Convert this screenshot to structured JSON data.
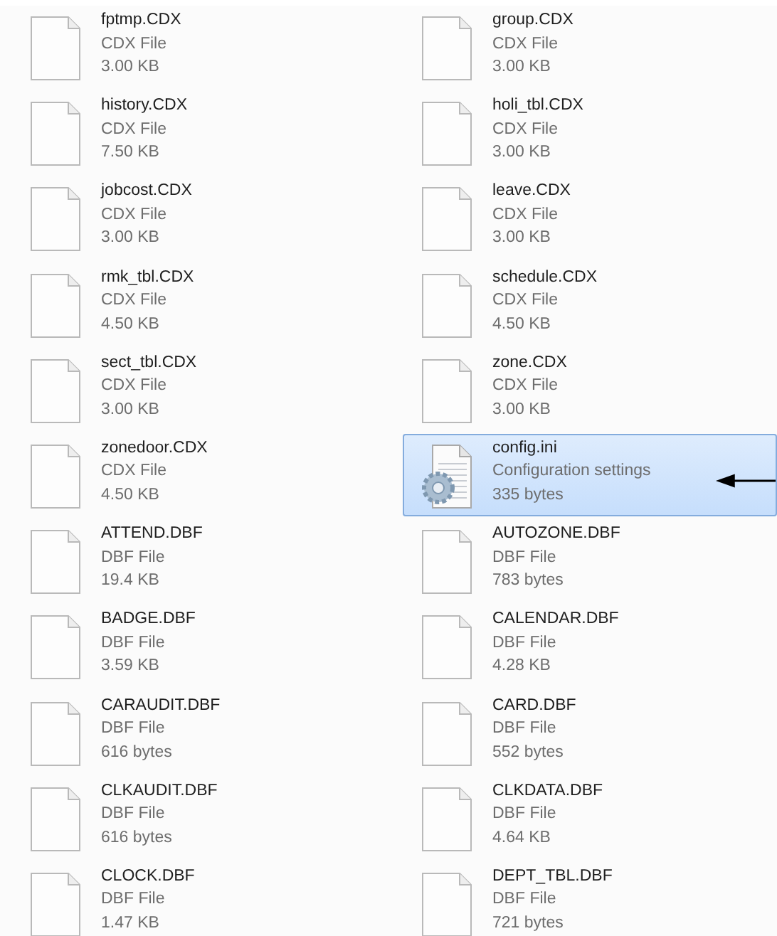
{
  "files": [
    {
      "name": "fptmp.CDX",
      "type": "CDX File",
      "size": "3.00 KB",
      "kind": "document",
      "selected": false
    },
    {
      "name": "group.CDX",
      "type": "CDX File",
      "size": "3.00 KB",
      "kind": "document",
      "selected": false
    },
    {
      "name": "history.CDX",
      "type": "CDX File",
      "size": "7.50 KB",
      "kind": "document",
      "selected": false
    },
    {
      "name": "holi_tbl.CDX",
      "type": "CDX File",
      "size": "3.00 KB",
      "kind": "document",
      "selected": false
    },
    {
      "name": "jobcost.CDX",
      "type": "CDX File",
      "size": "3.00 KB",
      "kind": "document",
      "selected": false
    },
    {
      "name": "leave.CDX",
      "type": "CDX File",
      "size": "3.00 KB",
      "kind": "document",
      "selected": false
    },
    {
      "name": "rmk_tbl.CDX",
      "type": "CDX File",
      "size": "4.50 KB",
      "kind": "document",
      "selected": false
    },
    {
      "name": "schedule.CDX",
      "type": "CDX File",
      "size": "4.50 KB",
      "kind": "document",
      "selected": false
    },
    {
      "name": "sect_tbl.CDX",
      "type": "CDX File",
      "size": "3.00 KB",
      "kind": "document",
      "selected": false
    },
    {
      "name": "zone.CDX",
      "type": "CDX File",
      "size": "3.00 KB",
      "kind": "document",
      "selected": false
    },
    {
      "name": "zonedoor.CDX",
      "type": "CDX File",
      "size": "4.50 KB",
      "kind": "document",
      "selected": false
    },
    {
      "name": "config.ini",
      "type": "Configuration settings",
      "size": "335 bytes",
      "kind": "settings",
      "selected": true,
      "pointed": true
    },
    {
      "name": "ATTEND.DBF",
      "type": "DBF File",
      "size": "19.4 KB",
      "kind": "document",
      "selected": false
    },
    {
      "name": "AUTOZONE.DBF",
      "type": "DBF File",
      "size": "783 bytes",
      "kind": "document",
      "selected": false
    },
    {
      "name": "BADGE.DBF",
      "type": "DBF File",
      "size": "3.59 KB",
      "kind": "document",
      "selected": false
    },
    {
      "name": "CALENDAR.DBF",
      "type": "DBF File",
      "size": "4.28 KB",
      "kind": "document",
      "selected": false
    },
    {
      "name": "CARAUDIT.DBF",
      "type": "DBF File",
      "size": "616 bytes",
      "kind": "document",
      "selected": false
    },
    {
      "name": "CARD.DBF",
      "type": "DBF File",
      "size": "552 bytes",
      "kind": "document",
      "selected": false
    },
    {
      "name": "CLKAUDIT.DBF",
      "type": "DBF File",
      "size": "616 bytes",
      "kind": "document",
      "selected": false
    },
    {
      "name": "CLKDATA.DBF",
      "type": "DBF File",
      "size": "4.64 KB",
      "kind": "document",
      "selected": false
    },
    {
      "name": "CLOCK.DBF",
      "type": "DBF File",
      "size": "1.47 KB",
      "kind": "document",
      "selected": false
    },
    {
      "name": "DEPT_TBL.DBF",
      "type": "DBF File",
      "size": "721 bytes",
      "kind": "document",
      "selected": false
    }
  ]
}
